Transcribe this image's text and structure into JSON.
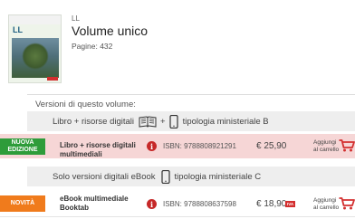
{
  "book": {
    "cover_title": "LL",
    "code": "LL",
    "title": "Volume unico",
    "pages": "Pagine: 432"
  },
  "versions_label": "Versioni di questo volume:",
  "groups": [
    {
      "title_left": "Libro + risorse digitali",
      "plus": "+",
      "title_right": "tipologia ministeriale B",
      "icons": [
        "open-book-icon",
        "tablet-icon"
      ],
      "product": {
        "badge": "NUOVA EDIZIONE",
        "badge_color": "#2e9c3a",
        "name": "Libro + risorse digitali multimediali",
        "isbn": "ISBN: 9788808921291",
        "price": "€ 25,90",
        "cart": "Aggiungi al carrello"
      }
    },
    {
      "title_left": "Solo versioni digitali eBook",
      "title_right": "tipologia ministeriale C",
      "icons": [
        "tablet-icon"
      ],
      "product": {
        "badge": "NOVITÀ",
        "badge_color": "#f07b1c",
        "name": "eBook multimediale Booktab",
        "isbn": "ISBN: 9788808637598",
        "price": "€ 18,90",
        "iva": "IVA",
        "cart": "Aggiungi al carrello"
      }
    }
  ],
  "colors": {
    "accent_red": "#c62828",
    "row_highlight": "#f6d6d6",
    "group_header": "#eeeeee"
  }
}
